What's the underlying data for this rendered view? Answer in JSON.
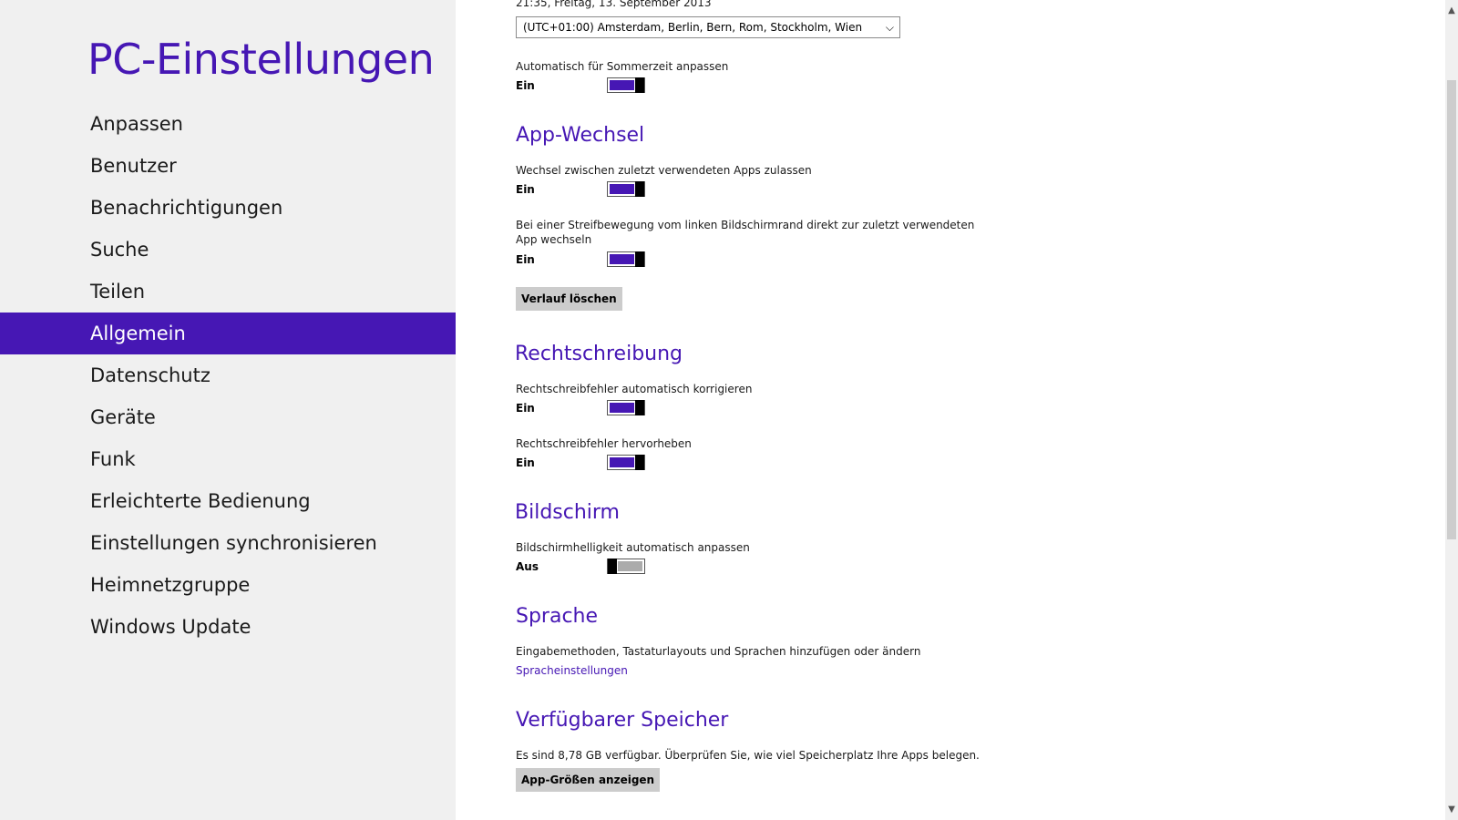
{
  "sidebar": {
    "title": "PC-Einstellungen",
    "items": [
      {
        "label": "Anpassen"
      },
      {
        "label": "Benutzer"
      },
      {
        "label": "Benachrichtigungen"
      },
      {
        "label": "Suche"
      },
      {
        "label": "Teilen"
      },
      {
        "label": "Allgemein",
        "active": true
      },
      {
        "label": "Datenschutz"
      },
      {
        "label": "Geräte"
      },
      {
        "label": "Funk"
      },
      {
        "label": "Erleichterte Bedienung"
      },
      {
        "label": "Einstellungen synchronisieren"
      },
      {
        "label": "Heimnetzgruppe"
      },
      {
        "label": "Windows Update"
      }
    ]
  },
  "time": {
    "datetime": "21:35, Freitag, 13. September 2013",
    "timezone_value": "(UTC+01:00) Amsterdam, Berlin, Bern, Rom, Stockholm, Wien",
    "dst_label": "Automatisch für Sommerzeit anpassen",
    "dst_state": "Ein"
  },
  "app_switch": {
    "heading": "App-Wechsel",
    "switch_label": "Wechsel zwischen zuletzt verwendeten Apps zulassen",
    "switch_state": "Ein",
    "swipe_label_line1": "Bei einer Streifbewegung vom linken Bildschirmrand direkt zur zuletzt verwendeten",
    "swipe_label_line2": "App wechseln",
    "swipe_state": "Ein",
    "clear_button": "Verlauf löschen"
  },
  "spelling": {
    "heading": "Rechtschreibung",
    "autocorrect_label": "Rechtschreibfehler automatisch korrigieren",
    "autocorrect_state": "Ein",
    "highlight_label": "Rechtschreibfehler hervorheben",
    "highlight_state": "Ein"
  },
  "screen": {
    "heading": "Bildschirm",
    "brightness_label": "Bildschirmhelligkeit automatisch anpassen",
    "brightness_state": "Aus"
  },
  "language": {
    "heading": "Sprache",
    "description": "Eingabemethoden, Tastaturlayouts und Sprachen hinzufügen oder ändern",
    "link": "Spracheinstellungen"
  },
  "storage": {
    "heading": "Verfügbarer Speicher",
    "description": "Es sind 8,78 GB verfügbar. Überprüfen Sie, wie viel Speicherplatz Ihre Apps belegen.",
    "button": "App-Größen anzeigen"
  },
  "colors": {
    "accent": "#4617b4",
    "sidebar_bg": "#f0f0f0",
    "button_bg": "#cccccc"
  }
}
